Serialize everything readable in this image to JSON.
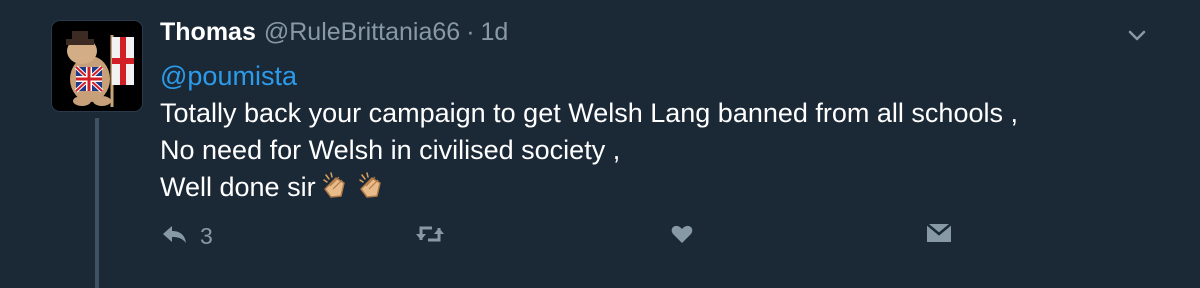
{
  "tweet": {
    "display_name": "Thomas",
    "handle": "@RuleBrittania66",
    "separator": "·",
    "timestamp": "1d",
    "mention": "@poumista",
    "lines": [
      "Totally back your campaign to get Welsh Lang banned from all schools ,",
      "No need for Welsh in civilised society ,",
      "Well done sir"
    ],
    "emoji": [
      "clapping-hands-icon",
      "clapping-hands-icon"
    ]
  },
  "actions": {
    "reply_count": "3",
    "icons": [
      "reply-icon",
      "retweet-icon",
      "like-icon",
      "direct-message-icon",
      "chevron-down-icon"
    ]
  },
  "colors": {
    "background": "#1b2836",
    "text": "#ffffff",
    "secondary": "#8899a6",
    "link": "#2b9bea",
    "thread_line": "#3f5164"
  }
}
